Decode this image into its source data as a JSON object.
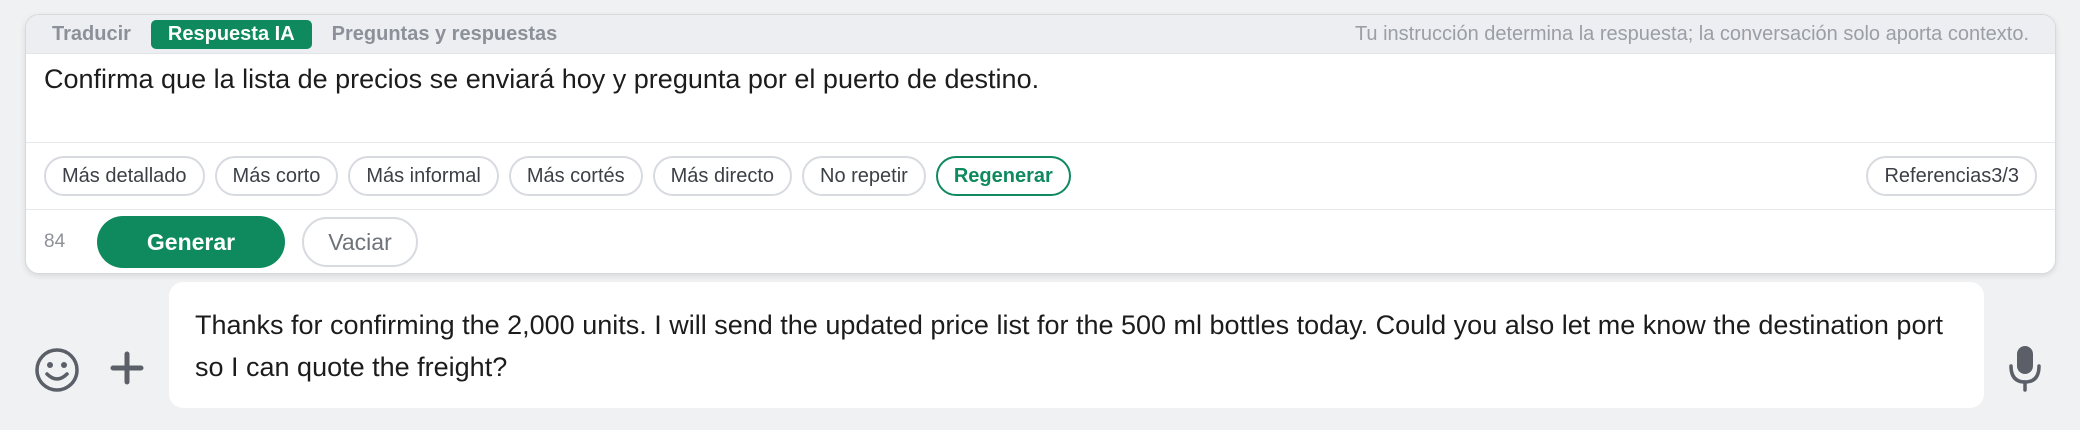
{
  "tabs": [
    {
      "label": "Traducir",
      "active": false
    },
    {
      "label": "Respuesta IA",
      "active": true
    },
    {
      "label": "Preguntas y respuestas",
      "active": false
    }
  ],
  "hint": "Tu instrucción determina la respuesta; la conversación solo aporta contexto.",
  "instruction": "Confirma que la lista de precios se enviará hoy y pregunta por el puerto de destino.",
  "chips": [
    "Más detallado",
    "Más corto",
    "Más informal",
    "Más cortés",
    "Más directo",
    "No repetir"
  ],
  "regenerate_label": "Regenerar",
  "references_label": "Referencias3/3",
  "char_count": "84",
  "generate_label": "Generar",
  "clear_label": "Vaciar",
  "composer": {
    "text": "Thanks for confirming the 2,000 units. I will send the updated price list for the 500 ml bottles today. Could you also let me know the destination port so I can quote the freight?"
  },
  "colors": {
    "accent": "#0f8a5f",
    "background": "#f0f1f3",
    "panel": "#ffffff"
  },
  "icons": [
    "smiley-icon",
    "plus-icon",
    "microphone-icon"
  ]
}
